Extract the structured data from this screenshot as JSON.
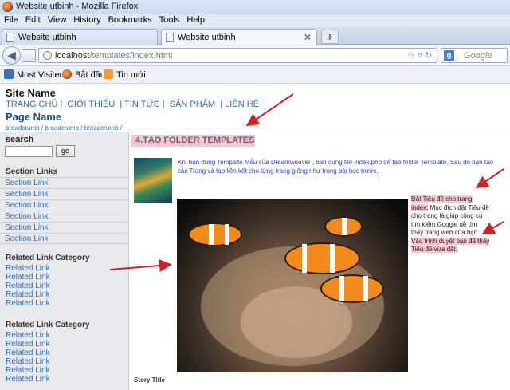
{
  "window": {
    "title": "Website utbinh - Mozilla Firefox"
  },
  "menu": [
    "File",
    "Edit",
    "View",
    "History",
    "Bookmarks",
    "Tools",
    "Help"
  ],
  "tabs": [
    {
      "label": "Website utbinh",
      "active": false
    },
    {
      "label": "Website utbinh",
      "active": true
    }
  ],
  "nav": {
    "url_host": "localhost",
    "url_path": "/templates/index.html",
    "search_placeholder": "Google"
  },
  "bookmarks": [
    {
      "label": "Most Visited",
      "icon": "most-visited-icon"
    },
    {
      "label": "Bắt đầu",
      "icon": "firefox-icon"
    },
    {
      "label": "Tin mới",
      "icon": "rss-icon"
    }
  ],
  "site": {
    "name": "Site Name",
    "topnav": [
      "TRANG CHỦ |",
      "GIỚI THIỆU",
      "| TIN TỨC |",
      "SẢN PHẨM",
      "| LIÊN HỆ",
      "|"
    ],
    "page_name": "Page Name",
    "breadcrumb": "breadcrumb / breadcrumb / breadcrumb /"
  },
  "sidebar": {
    "search_label": "search",
    "go_label": "go",
    "section_heading": "Section Links",
    "section_links": [
      "Section Link",
      "Section Link",
      "Section Link",
      "Section Link",
      "Section Link",
      "Section Link"
    ],
    "related_heading_1": "Related Link Category",
    "related_links_1": [
      "Related Link",
      "Related Link",
      "Related Link",
      "Related Link",
      "Related Link"
    ],
    "related_heading_2": "Related Link Category",
    "related_links_2": [
      "Related Link",
      "Related Link",
      "Related Link",
      "Related Link",
      "Related Link",
      "Related Link"
    ]
  },
  "main": {
    "heading": "4.TẠO FOLDER TEMPLATES",
    "intro": "Khi bạn dùng Tempalte Mẫu của Dreamweaver , bạn dùng file index.php để tạo folder Template. Sau đó bạn tạo các Trang và tạo liên kết cho từng trang giống như trong bài học trước.",
    "note_1": "Đặt Tiêu đề cho trang index:",
    "note_2": " Mục đích đặt Tiêu đề cho trang là giúp công cụ tìm kiếm Google dễ tìm thấy trang web của bạn",
    "note_3": "Vào trình duyệt bạn đã thấy Tiêu đề vừa đặt.",
    "story_title": "Story Title"
  },
  "colors": {
    "link": "#2d6fb6",
    "highlight": "#f8c6cf",
    "arrow": "#d21f2a"
  }
}
